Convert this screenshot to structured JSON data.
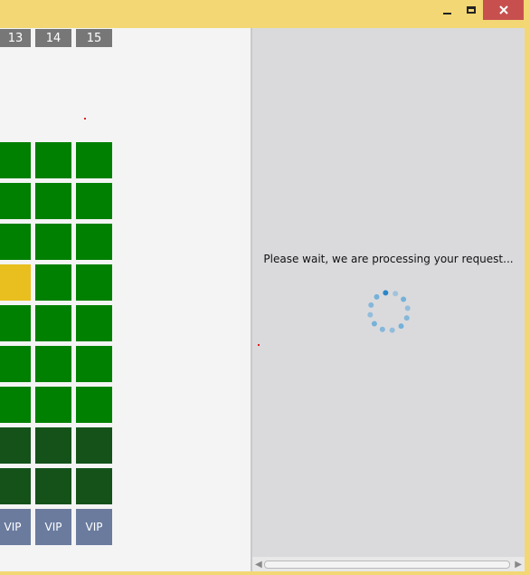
{
  "window": {
    "frame_color": "#f2d774",
    "controls": {
      "minimize_icon": "minimize-icon",
      "maximize_icon": "maximize-icon",
      "close_icon": "close-icon",
      "close_color": "#c7504f"
    }
  },
  "seat_map": {
    "column_headers": [
      "13",
      "14",
      "15"
    ],
    "vip_label": "VIP",
    "colors": {
      "available": "#008000",
      "selected": "#e9bf1f",
      "dark": "#14521a",
      "vip": "#6a7b9e",
      "header": "#777777"
    },
    "rows": [
      [
        "available",
        "available",
        "available"
      ],
      [
        "available",
        "available",
        "available"
      ],
      [
        "available",
        "available",
        "available"
      ],
      [
        "selected",
        "available",
        "available"
      ],
      [
        "available",
        "available",
        "available"
      ],
      [
        "available",
        "available",
        "available"
      ],
      [
        "available",
        "available",
        "available"
      ],
      [
        "dark",
        "dark",
        "dark"
      ],
      [
        "dark",
        "dark",
        "dark"
      ],
      [
        "vip",
        "vip",
        "vip"
      ]
    ]
  },
  "processing": {
    "message": "Please wait, we are processing your request...",
    "spinner_icon": "loading-spinner-icon"
  }
}
